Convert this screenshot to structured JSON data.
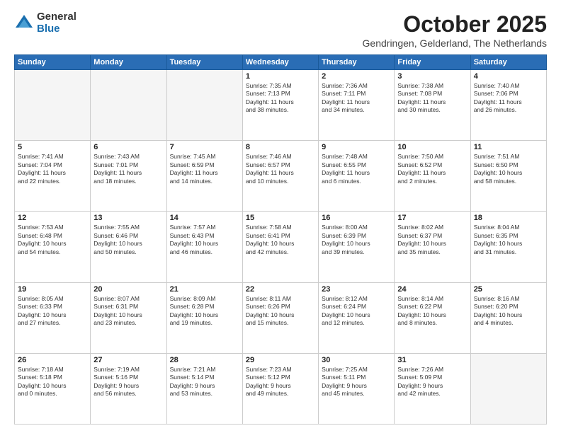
{
  "logo": {
    "general": "General",
    "blue": "Blue"
  },
  "header": {
    "month": "October 2025",
    "location": "Gendringen, Gelderland, The Netherlands"
  },
  "weekdays": [
    "Sunday",
    "Monday",
    "Tuesday",
    "Wednesday",
    "Thursday",
    "Friday",
    "Saturday"
  ],
  "weeks": [
    [
      {
        "day": "",
        "info": ""
      },
      {
        "day": "",
        "info": ""
      },
      {
        "day": "",
        "info": ""
      },
      {
        "day": "1",
        "info": "Sunrise: 7:35 AM\nSunset: 7:13 PM\nDaylight: 11 hours\nand 38 minutes."
      },
      {
        "day": "2",
        "info": "Sunrise: 7:36 AM\nSunset: 7:11 PM\nDaylight: 11 hours\nand 34 minutes."
      },
      {
        "day": "3",
        "info": "Sunrise: 7:38 AM\nSunset: 7:08 PM\nDaylight: 11 hours\nand 30 minutes."
      },
      {
        "day": "4",
        "info": "Sunrise: 7:40 AM\nSunset: 7:06 PM\nDaylight: 11 hours\nand 26 minutes."
      }
    ],
    [
      {
        "day": "5",
        "info": "Sunrise: 7:41 AM\nSunset: 7:04 PM\nDaylight: 11 hours\nand 22 minutes."
      },
      {
        "day": "6",
        "info": "Sunrise: 7:43 AM\nSunset: 7:01 PM\nDaylight: 11 hours\nand 18 minutes."
      },
      {
        "day": "7",
        "info": "Sunrise: 7:45 AM\nSunset: 6:59 PM\nDaylight: 11 hours\nand 14 minutes."
      },
      {
        "day": "8",
        "info": "Sunrise: 7:46 AM\nSunset: 6:57 PM\nDaylight: 11 hours\nand 10 minutes."
      },
      {
        "day": "9",
        "info": "Sunrise: 7:48 AM\nSunset: 6:55 PM\nDaylight: 11 hours\nand 6 minutes."
      },
      {
        "day": "10",
        "info": "Sunrise: 7:50 AM\nSunset: 6:52 PM\nDaylight: 11 hours\nand 2 minutes."
      },
      {
        "day": "11",
        "info": "Sunrise: 7:51 AM\nSunset: 6:50 PM\nDaylight: 10 hours\nand 58 minutes."
      }
    ],
    [
      {
        "day": "12",
        "info": "Sunrise: 7:53 AM\nSunset: 6:48 PM\nDaylight: 10 hours\nand 54 minutes."
      },
      {
        "day": "13",
        "info": "Sunrise: 7:55 AM\nSunset: 6:46 PM\nDaylight: 10 hours\nand 50 minutes."
      },
      {
        "day": "14",
        "info": "Sunrise: 7:57 AM\nSunset: 6:43 PM\nDaylight: 10 hours\nand 46 minutes."
      },
      {
        "day": "15",
        "info": "Sunrise: 7:58 AM\nSunset: 6:41 PM\nDaylight: 10 hours\nand 42 minutes."
      },
      {
        "day": "16",
        "info": "Sunrise: 8:00 AM\nSunset: 6:39 PM\nDaylight: 10 hours\nand 39 minutes."
      },
      {
        "day": "17",
        "info": "Sunrise: 8:02 AM\nSunset: 6:37 PM\nDaylight: 10 hours\nand 35 minutes."
      },
      {
        "day": "18",
        "info": "Sunrise: 8:04 AM\nSunset: 6:35 PM\nDaylight: 10 hours\nand 31 minutes."
      }
    ],
    [
      {
        "day": "19",
        "info": "Sunrise: 8:05 AM\nSunset: 6:33 PM\nDaylight: 10 hours\nand 27 minutes."
      },
      {
        "day": "20",
        "info": "Sunrise: 8:07 AM\nSunset: 6:31 PM\nDaylight: 10 hours\nand 23 minutes."
      },
      {
        "day": "21",
        "info": "Sunrise: 8:09 AM\nSunset: 6:28 PM\nDaylight: 10 hours\nand 19 minutes."
      },
      {
        "day": "22",
        "info": "Sunrise: 8:11 AM\nSunset: 6:26 PM\nDaylight: 10 hours\nand 15 minutes."
      },
      {
        "day": "23",
        "info": "Sunrise: 8:12 AM\nSunset: 6:24 PM\nDaylight: 10 hours\nand 12 minutes."
      },
      {
        "day": "24",
        "info": "Sunrise: 8:14 AM\nSunset: 6:22 PM\nDaylight: 10 hours\nand 8 minutes."
      },
      {
        "day": "25",
        "info": "Sunrise: 8:16 AM\nSunset: 6:20 PM\nDaylight: 10 hours\nand 4 minutes."
      }
    ],
    [
      {
        "day": "26",
        "info": "Sunrise: 7:18 AM\nSunset: 5:18 PM\nDaylight: 10 hours\nand 0 minutes."
      },
      {
        "day": "27",
        "info": "Sunrise: 7:19 AM\nSunset: 5:16 PM\nDaylight: 9 hours\nand 56 minutes."
      },
      {
        "day": "28",
        "info": "Sunrise: 7:21 AM\nSunset: 5:14 PM\nDaylight: 9 hours\nand 53 minutes."
      },
      {
        "day": "29",
        "info": "Sunrise: 7:23 AM\nSunset: 5:12 PM\nDaylight: 9 hours\nand 49 minutes."
      },
      {
        "day": "30",
        "info": "Sunrise: 7:25 AM\nSunset: 5:11 PM\nDaylight: 9 hours\nand 45 minutes."
      },
      {
        "day": "31",
        "info": "Sunrise: 7:26 AM\nSunset: 5:09 PM\nDaylight: 9 hours\nand 42 minutes."
      },
      {
        "day": "",
        "info": ""
      }
    ]
  ]
}
